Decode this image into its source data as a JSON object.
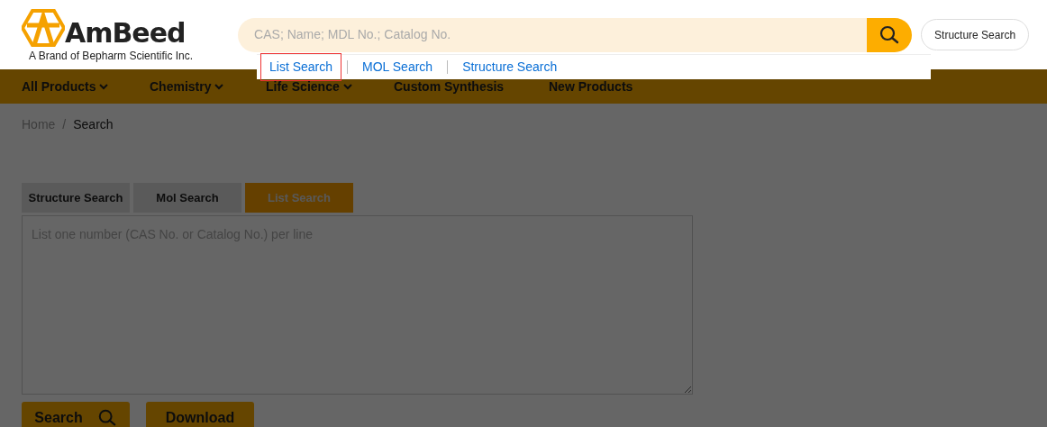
{
  "logo": {
    "name": "AmBeed",
    "tagline": "A Brand of Bepharm Scientific Inc."
  },
  "search": {
    "placeholder": "CAS; Name; MDL No.; Catalog No."
  },
  "header_button": "Structure Search",
  "search_modes": [
    {
      "label": "List Search",
      "selected": true
    },
    {
      "label": "MOL Search",
      "selected": false
    },
    {
      "label": "Structure Search",
      "selected": false
    }
  ],
  "nav": [
    {
      "label": "All Products",
      "dropdown": true
    },
    {
      "label": "Chemistry",
      "dropdown": true
    },
    {
      "label": "Life Science",
      "dropdown": true
    },
    {
      "label": "Custom Synthesis",
      "dropdown": false
    },
    {
      "label": "New Products",
      "dropdown": false
    }
  ],
  "breadcrumb": [
    "Home",
    "Search"
  ],
  "breadcrumb_separator": "/",
  "tabs": [
    {
      "label": "Structure Search",
      "selected": false
    },
    {
      "label": "Mol Search",
      "selected": false
    },
    {
      "label": "List Search",
      "selected": true
    }
  ],
  "list_field": {
    "placeholder": "List one number (CAS No. or Catalog No.) per line"
  },
  "buttons": [
    {
      "label": "Search",
      "kind": "search"
    },
    {
      "label": "Download",
      "kind": "plain"
    }
  ],
  "backdrop": true
}
